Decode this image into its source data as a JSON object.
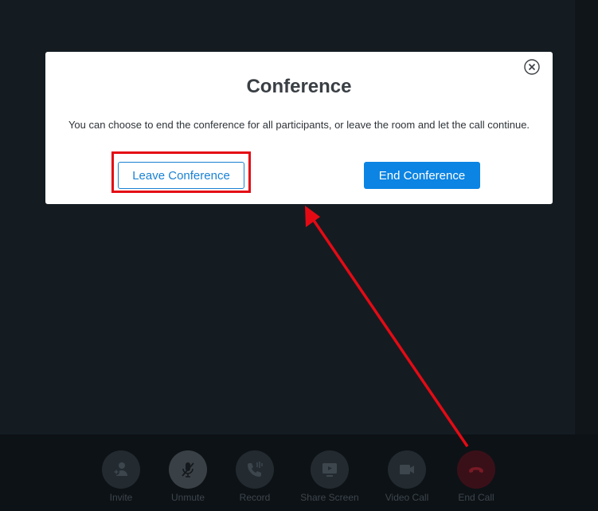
{
  "dialog": {
    "title": "Conference",
    "message": "You can choose to end the conference for all participants, or leave the room and let the call continue.",
    "leave_label": "Leave Conference",
    "end_label": "End Conference",
    "close_icon": "close-icon"
  },
  "toolbar": {
    "items": [
      {
        "label": "Invite",
        "icon": "add-user-icon"
      },
      {
        "label": "Unmute",
        "icon": "microphone-muted-icon"
      },
      {
        "label": "Record",
        "icon": "record-phone-icon"
      },
      {
        "label": "Share Screen",
        "icon": "share-screen-icon"
      },
      {
        "label": "Video Call",
        "icon": "video-camera-icon"
      },
      {
        "label": "End Call",
        "icon": "hang-up-icon"
      }
    ]
  },
  "annotation": {
    "highlight_color": "#e40a14"
  },
  "colors": {
    "primary": "#0b84e3",
    "background": "#141c22"
  }
}
